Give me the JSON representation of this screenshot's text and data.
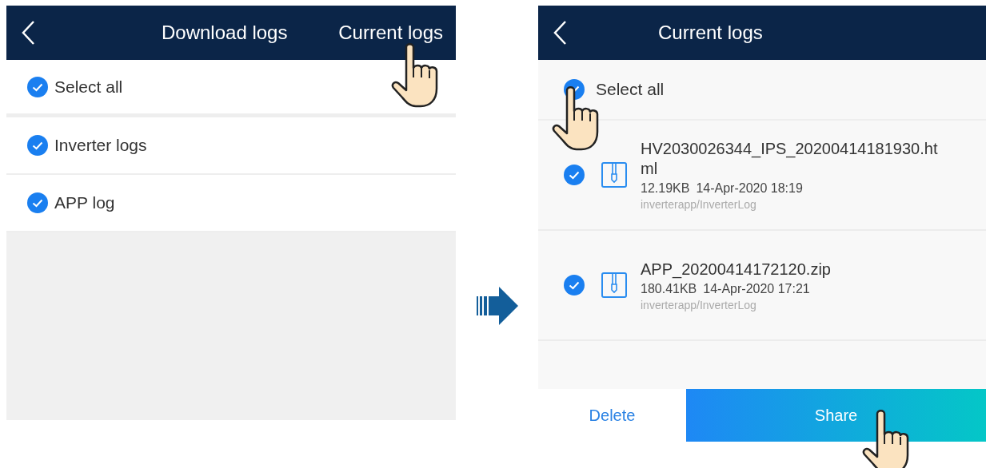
{
  "left_screen": {
    "header": {
      "title": "Download logs",
      "action": "Current logs"
    },
    "select_all": {
      "label": "Select all",
      "checked": true
    },
    "items": [
      {
        "label": "Inverter logs",
        "checked": true
      },
      {
        "label": "APP log",
        "checked": true
      }
    ]
  },
  "right_screen": {
    "header": {
      "title": "Current logs"
    },
    "select_all": {
      "label": "Select all",
      "checked": true
    },
    "files": [
      {
        "name": "HV2030026344_IPS_20200414181930.html",
        "size": "12.19KB",
        "date": "14-Apr-2020 18:19",
        "path": "inverterapp/InverterLog",
        "checked": true
      },
      {
        "name": "APP_20200414172120.zip",
        "size": "180.41KB",
        "date": "14-Apr-2020 17:21",
        "path": "inverterapp/InverterLog",
        "checked": true
      }
    ],
    "actions": {
      "delete": "Delete",
      "share": "Share"
    }
  }
}
